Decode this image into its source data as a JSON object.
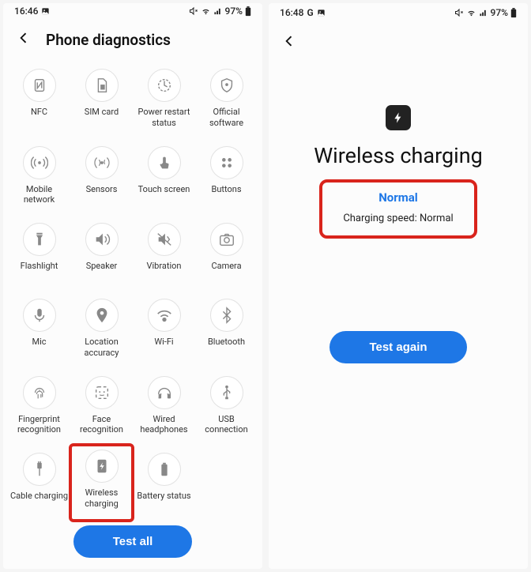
{
  "left": {
    "status": {
      "time": "16:46",
      "battery": "97%"
    },
    "header": {
      "title": "Phone diagnostics"
    },
    "items": [
      {
        "label": "NFC",
        "icon": "nfc"
      },
      {
        "label": "SIM card",
        "icon": "sim"
      },
      {
        "label": "Power restart status",
        "icon": "power"
      },
      {
        "label": "Official software",
        "icon": "shield"
      },
      {
        "label": "Mobile network",
        "icon": "antenna"
      },
      {
        "label": "Sensors",
        "icon": "sensors"
      },
      {
        "label": "Touch screen",
        "icon": "touch"
      },
      {
        "label": "Buttons",
        "icon": "buttons"
      },
      {
        "label": "Flashlight",
        "icon": "flashlight"
      },
      {
        "label": "Speaker",
        "icon": "speaker"
      },
      {
        "label": "Vibration",
        "icon": "vibration"
      },
      {
        "label": "Camera",
        "icon": "camera"
      },
      {
        "label": "Mic",
        "icon": "mic"
      },
      {
        "label": "Location accuracy",
        "icon": "location"
      },
      {
        "label": "Wi-Fi",
        "icon": "wifi"
      },
      {
        "label": "Bluetooth",
        "icon": "bluetooth"
      },
      {
        "label": "Fingerprint recognition",
        "icon": "fingerprint"
      },
      {
        "label": "Face recognition",
        "icon": "face"
      },
      {
        "label": "Wired headphones",
        "icon": "headphones"
      },
      {
        "label": "USB connection",
        "icon": "usb"
      },
      {
        "label": "Cable charging",
        "icon": "cable"
      },
      {
        "label": "Wireless charging",
        "icon": "bolt",
        "highlight": true
      },
      {
        "label": "Battery status",
        "icon": "battery"
      }
    ],
    "test_all": "Test all"
  },
  "right": {
    "status": {
      "time": "16:48",
      "apps": "G",
      "battery": "97%"
    },
    "title": "Wireless charging",
    "result_status": "Normal",
    "result_detail": "Charging speed: Normal",
    "test_again": "Test again"
  }
}
